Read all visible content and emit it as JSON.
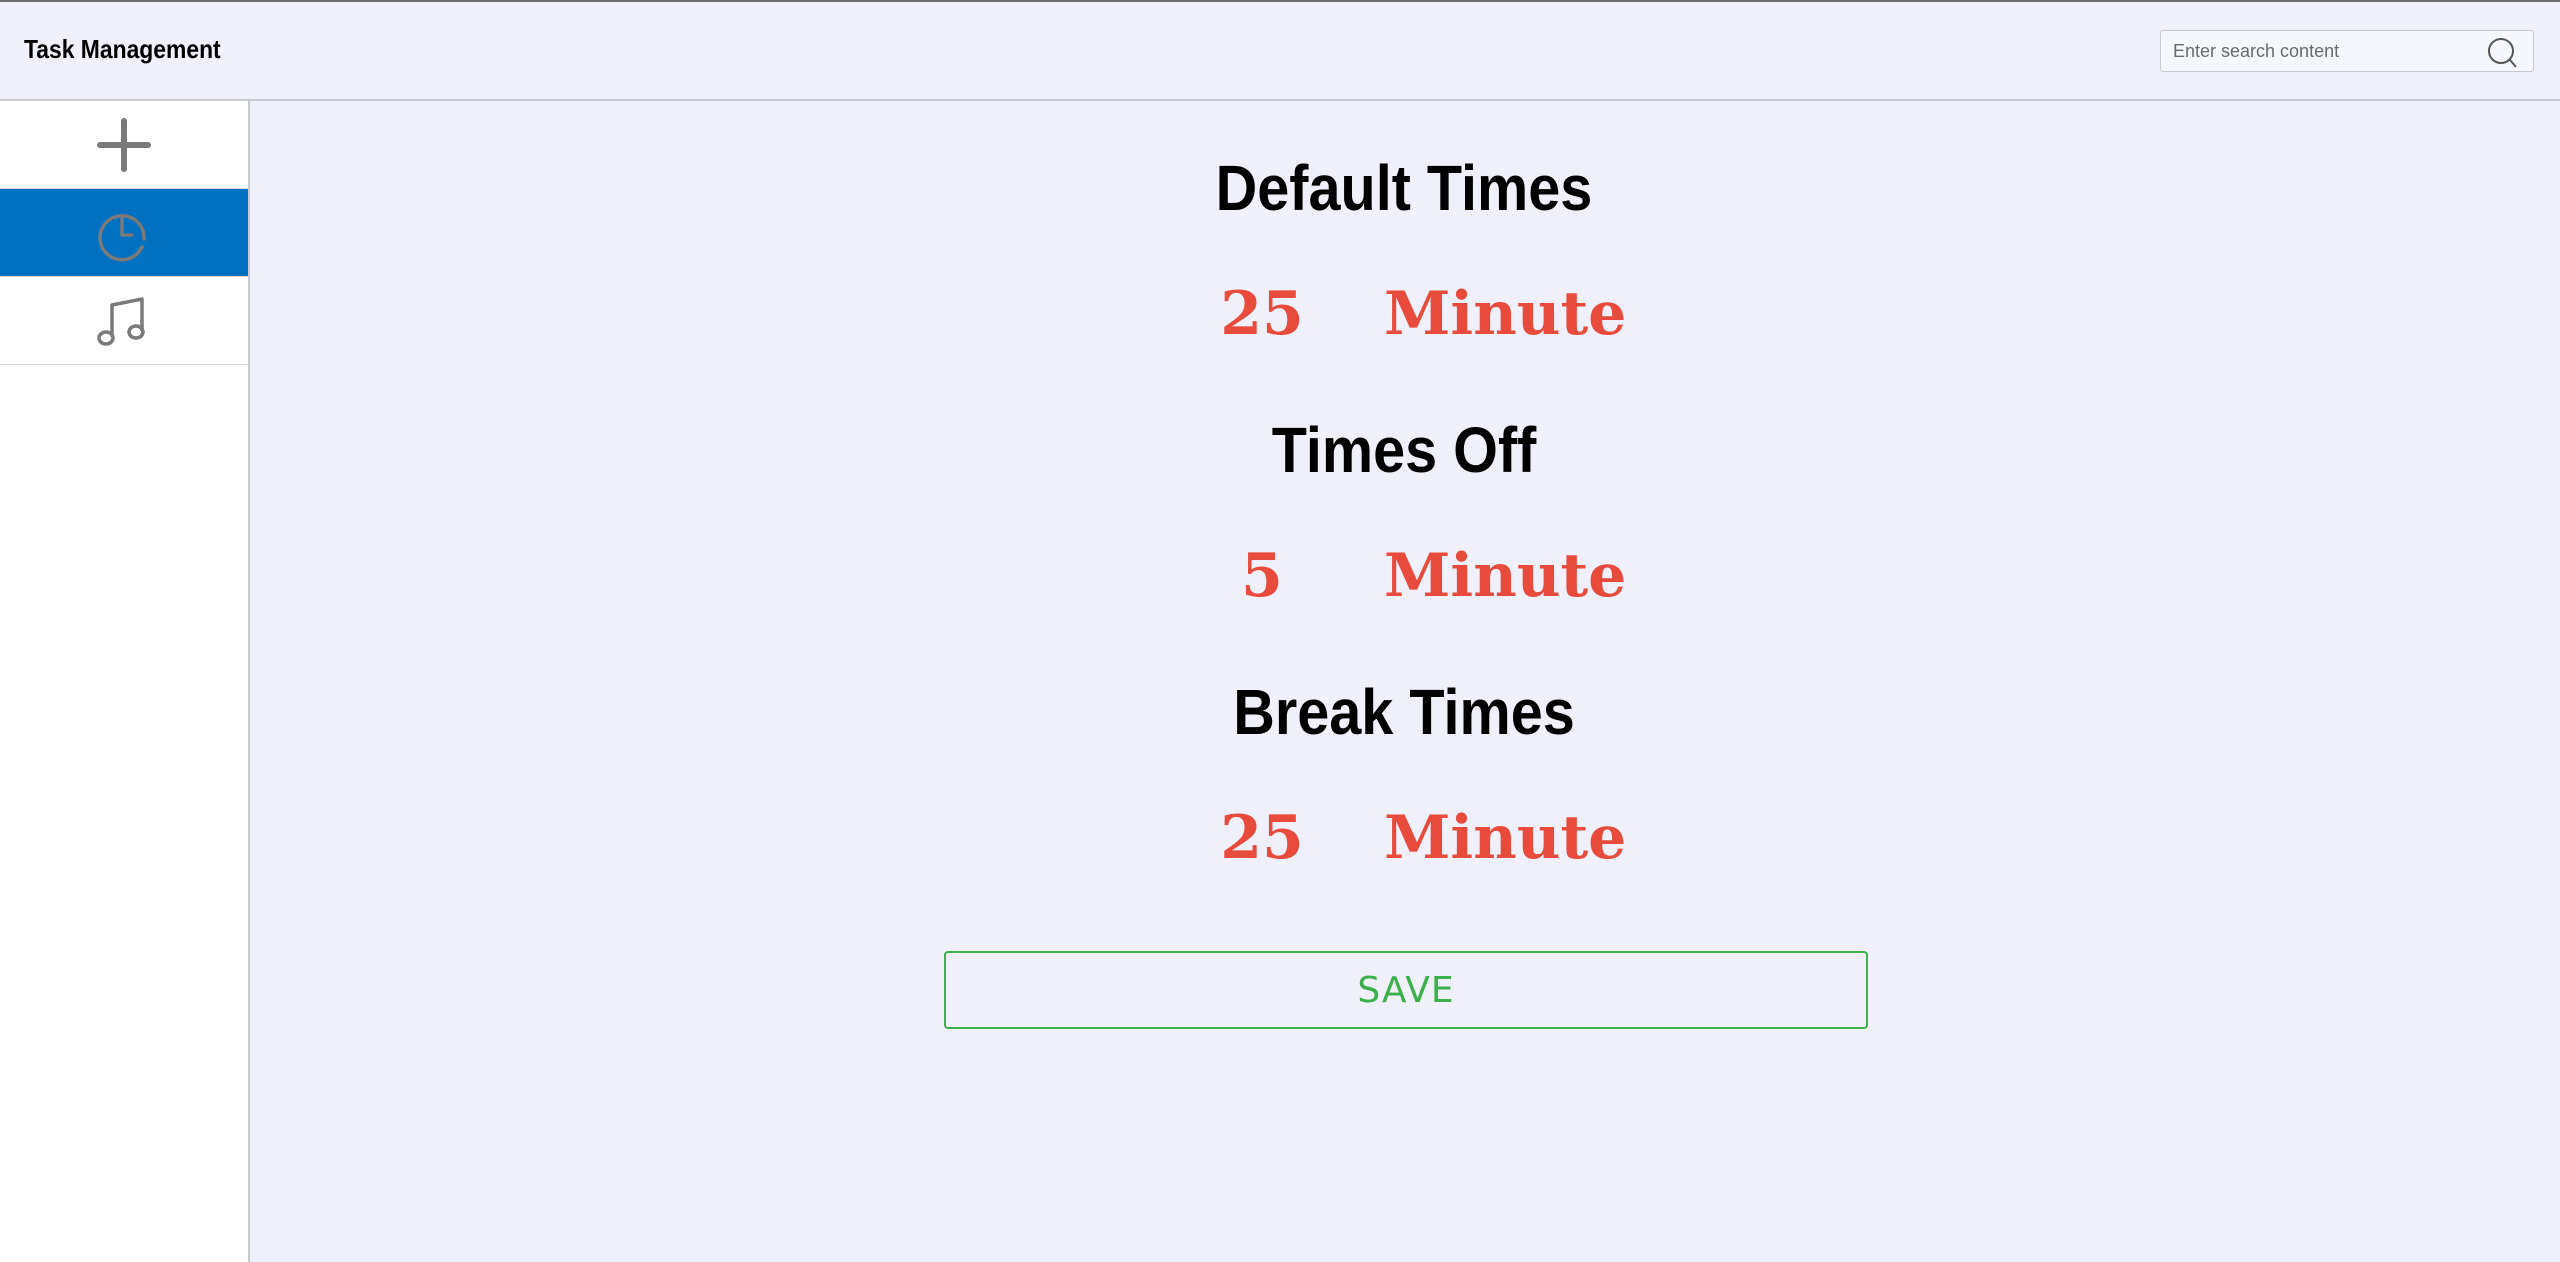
{
  "header": {
    "title": "Task Management",
    "search": {
      "placeholder": "Enter search content",
      "value": "",
      "icon": "search-icon"
    }
  },
  "sidebar": {
    "items": [
      {
        "name": "add",
        "icon": "plus-icon",
        "active": false
      },
      {
        "name": "timer",
        "icon": "clock-icon",
        "active": true
      },
      {
        "name": "music",
        "icon": "music-note-icon",
        "active": false
      }
    ]
  },
  "main": {
    "default_times": {
      "title": "Default Times",
      "value": "25",
      "unit": "Minute"
    },
    "times_off": {
      "title": "Times Off",
      "value": "5",
      "unit": "Minute"
    },
    "break_times": {
      "title": "Break Times",
      "value": "25",
      "unit": "Minute"
    },
    "save_label": "SAVE"
  },
  "colors": {
    "accent": "#0070c0",
    "value_red": "#e84a3c",
    "save_green": "#3cb04a",
    "background": "#eff0f9"
  }
}
